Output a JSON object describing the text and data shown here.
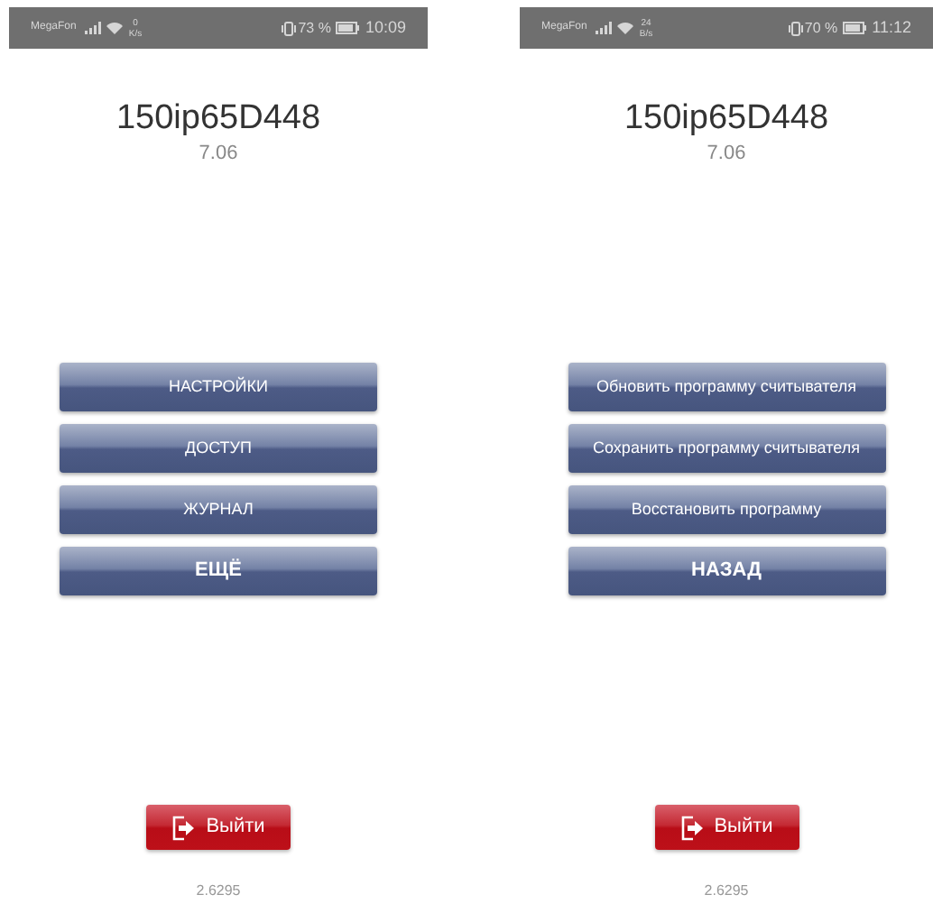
{
  "screens": [
    {
      "status_bar": {
        "carrier": "MegaFon",
        "speed": "0",
        "speed_unit": "K/s",
        "battery": "73 %",
        "time": "10:09"
      },
      "title": "150ip65D448",
      "version": "7.06",
      "buttons": [
        {
          "label": "НАСТРОЙКИ",
          "bold": false
        },
        {
          "label": "ДОСТУП",
          "bold": false
        },
        {
          "label": "ЖУРНАЛ",
          "bold": false
        },
        {
          "label": "ЕЩЁ",
          "bold": true
        }
      ],
      "exit_button": "Выйти",
      "build": "2.6295"
    },
    {
      "status_bar": {
        "carrier": "MegaFon",
        "speed": "24",
        "speed_unit": "B/s",
        "battery": "70 %",
        "time": "11:12"
      },
      "title": "150ip65D448",
      "version": "7.06",
      "buttons": [
        {
          "label": "Обновить программу считывателя",
          "bold": false
        },
        {
          "label": "Сохранить программу считывателя",
          "bold": false
        },
        {
          "label": "Восстановить программу",
          "bold": false
        },
        {
          "label": "НАЗАД",
          "bold": true
        }
      ],
      "exit_button": "Выйти",
      "build": "2.6295"
    }
  ]
}
